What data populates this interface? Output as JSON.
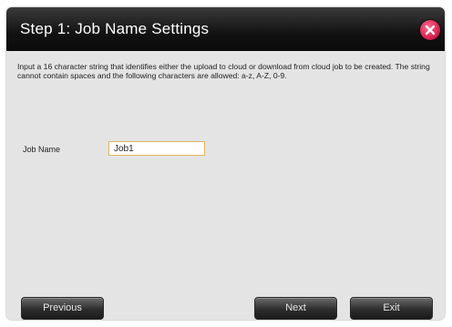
{
  "dialog": {
    "title": "Step 1: Job Name Settings",
    "close_icon": "close-icon",
    "accent_color": "#d11a4a"
  },
  "content": {
    "description": "Input a 16 character string that identifies either the upload to cloud or download from cloud job to be created. The string cannot contain spaces and the following characters are allowed: a-z, A-Z, 0-9.",
    "job_name_label": "Job Name",
    "job_name_value": "Job1"
  },
  "buttons": {
    "previous": "Previous",
    "next": "Next",
    "exit": "Exit"
  }
}
